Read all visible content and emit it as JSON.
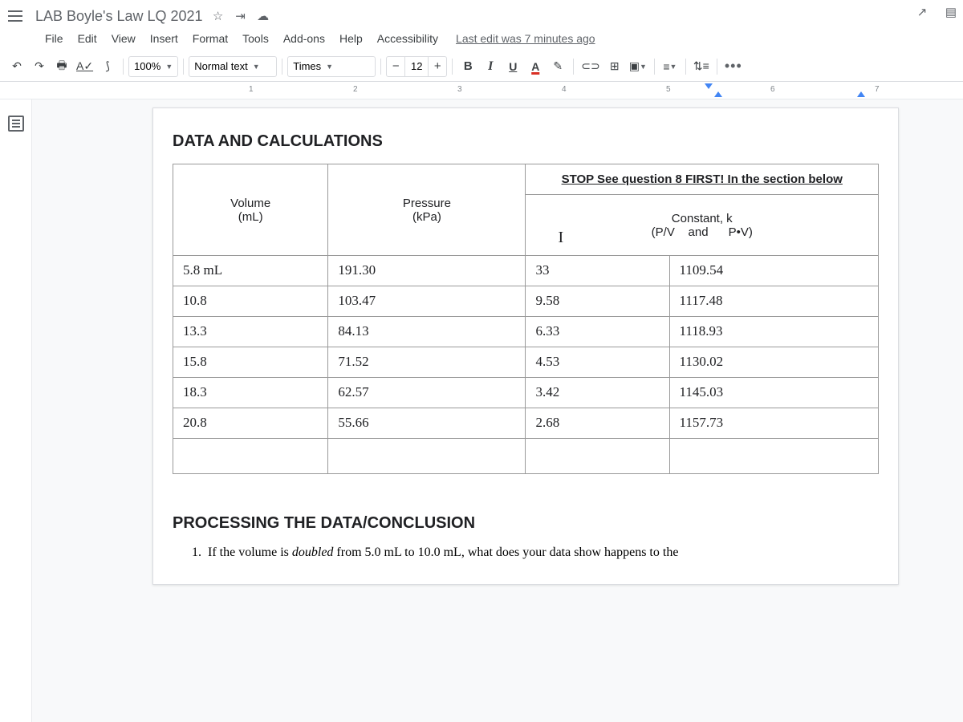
{
  "title": "LAB Boyle's Law LQ 2021",
  "menu": [
    "File",
    "Edit",
    "View",
    "Insert",
    "Format",
    "Tools",
    "Add-ons",
    "Help",
    "Accessibility"
  ],
  "last_edit": "Last edit was 7 minutes ago",
  "toolbar": {
    "zoom": "100%",
    "style": "Normal text",
    "font": "Times",
    "font_size": "12"
  },
  "ruler_numbers": [
    "1",
    "2",
    "3",
    "4",
    "5",
    "6",
    "7"
  ],
  "doc": {
    "heading1": "DATA AND CALCULATIONS",
    "table": {
      "stop_text": "STOP See question 8  FIRST! In the section below",
      "headers": {
        "col1_line1": "Volume",
        "col1_line2": "(mL)",
        "col2_line1": "Pressure",
        "col2_line2": "(kPa)",
        "merged_line1": "Constant, k",
        "merged_line2_a": "(P/V",
        "merged_line2_b": "and",
        "merged_line2_c": "P•V)"
      },
      "rows": [
        {
          "vol": "5.8 mL",
          "press": "191.30",
          "pv_div": "33",
          "pv_mul": "1109.54"
        },
        {
          "vol": "10.8",
          "press": "103.47",
          "pv_div": "9.58",
          "pv_mul": "1117.48"
        },
        {
          "vol": "13.3",
          "press": "84.13",
          "pv_div": "6.33",
          "pv_mul": "1118.93"
        },
        {
          "vol": "15.8",
          "press": "71.52",
          "pv_div": "4.53",
          "pv_mul": "1130.02"
        },
        {
          "vol": "18.3",
          "press": "62.57",
          "pv_div": "3.42",
          "pv_mul": "1145.03"
        },
        {
          "vol": "20.8",
          "press": "55.66",
          "pv_div": "2.68",
          "pv_mul": "1157.73"
        }
      ]
    },
    "heading2": "PROCESSING THE DATA/CONCLUSION",
    "q1_num": "1.",
    "q1_a": "If the volume is ",
    "q1_doubled": "doubled",
    "q1_b": " from 5.0 mL to 10.0 mL, what does your data show happens to the"
  },
  "cursor": "I"
}
